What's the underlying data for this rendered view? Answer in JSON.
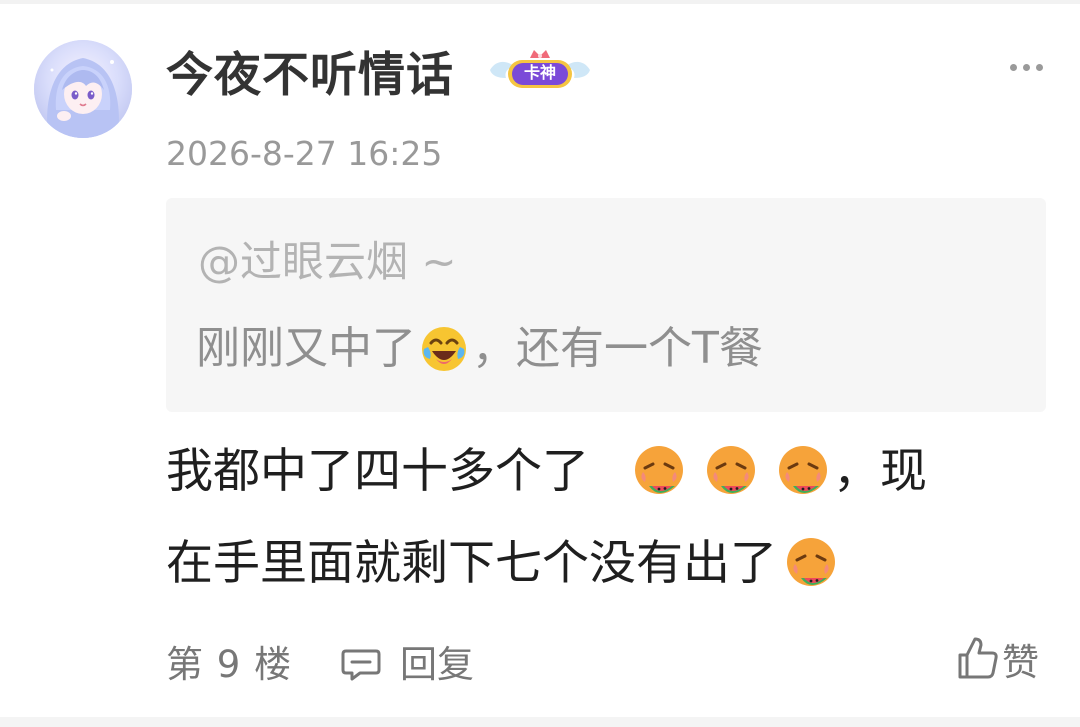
{
  "post": {
    "username": "今夜不听情话",
    "badge_text": "卡神",
    "timestamp": "2026-8-27 16:25"
  },
  "quote": {
    "mention": "@过眼云烟 ~",
    "text_before": "刚刚又中了",
    "text_after": "，还有一个T餐",
    "emoji": "crying-laughing-emoji"
  },
  "comment": {
    "line1_text": "我都中了四十多个了",
    "line1_suffix": "，现",
    "line2_text": "在手里面就剩下七个没有出了",
    "emoji": "eating-watermelon-face-emoji"
  },
  "footer": {
    "floor_label": "第 9 楼",
    "reply_label": "回复",
    "like_label": "赞"
  },
  "icons": {
    "more": "more-horizontal-icon",
    "reply": "comment-bubble-icon",
    "like": "thumbs-up-icon"
  },
  "colors": {
    "username": "#333333",
    "meta_gray": "#999999",
    "quote_bg": "#f6f6f6",
    "badge_purple": "#7b4ad8",
    "badge_gold": "#f5c542"
  }
}
